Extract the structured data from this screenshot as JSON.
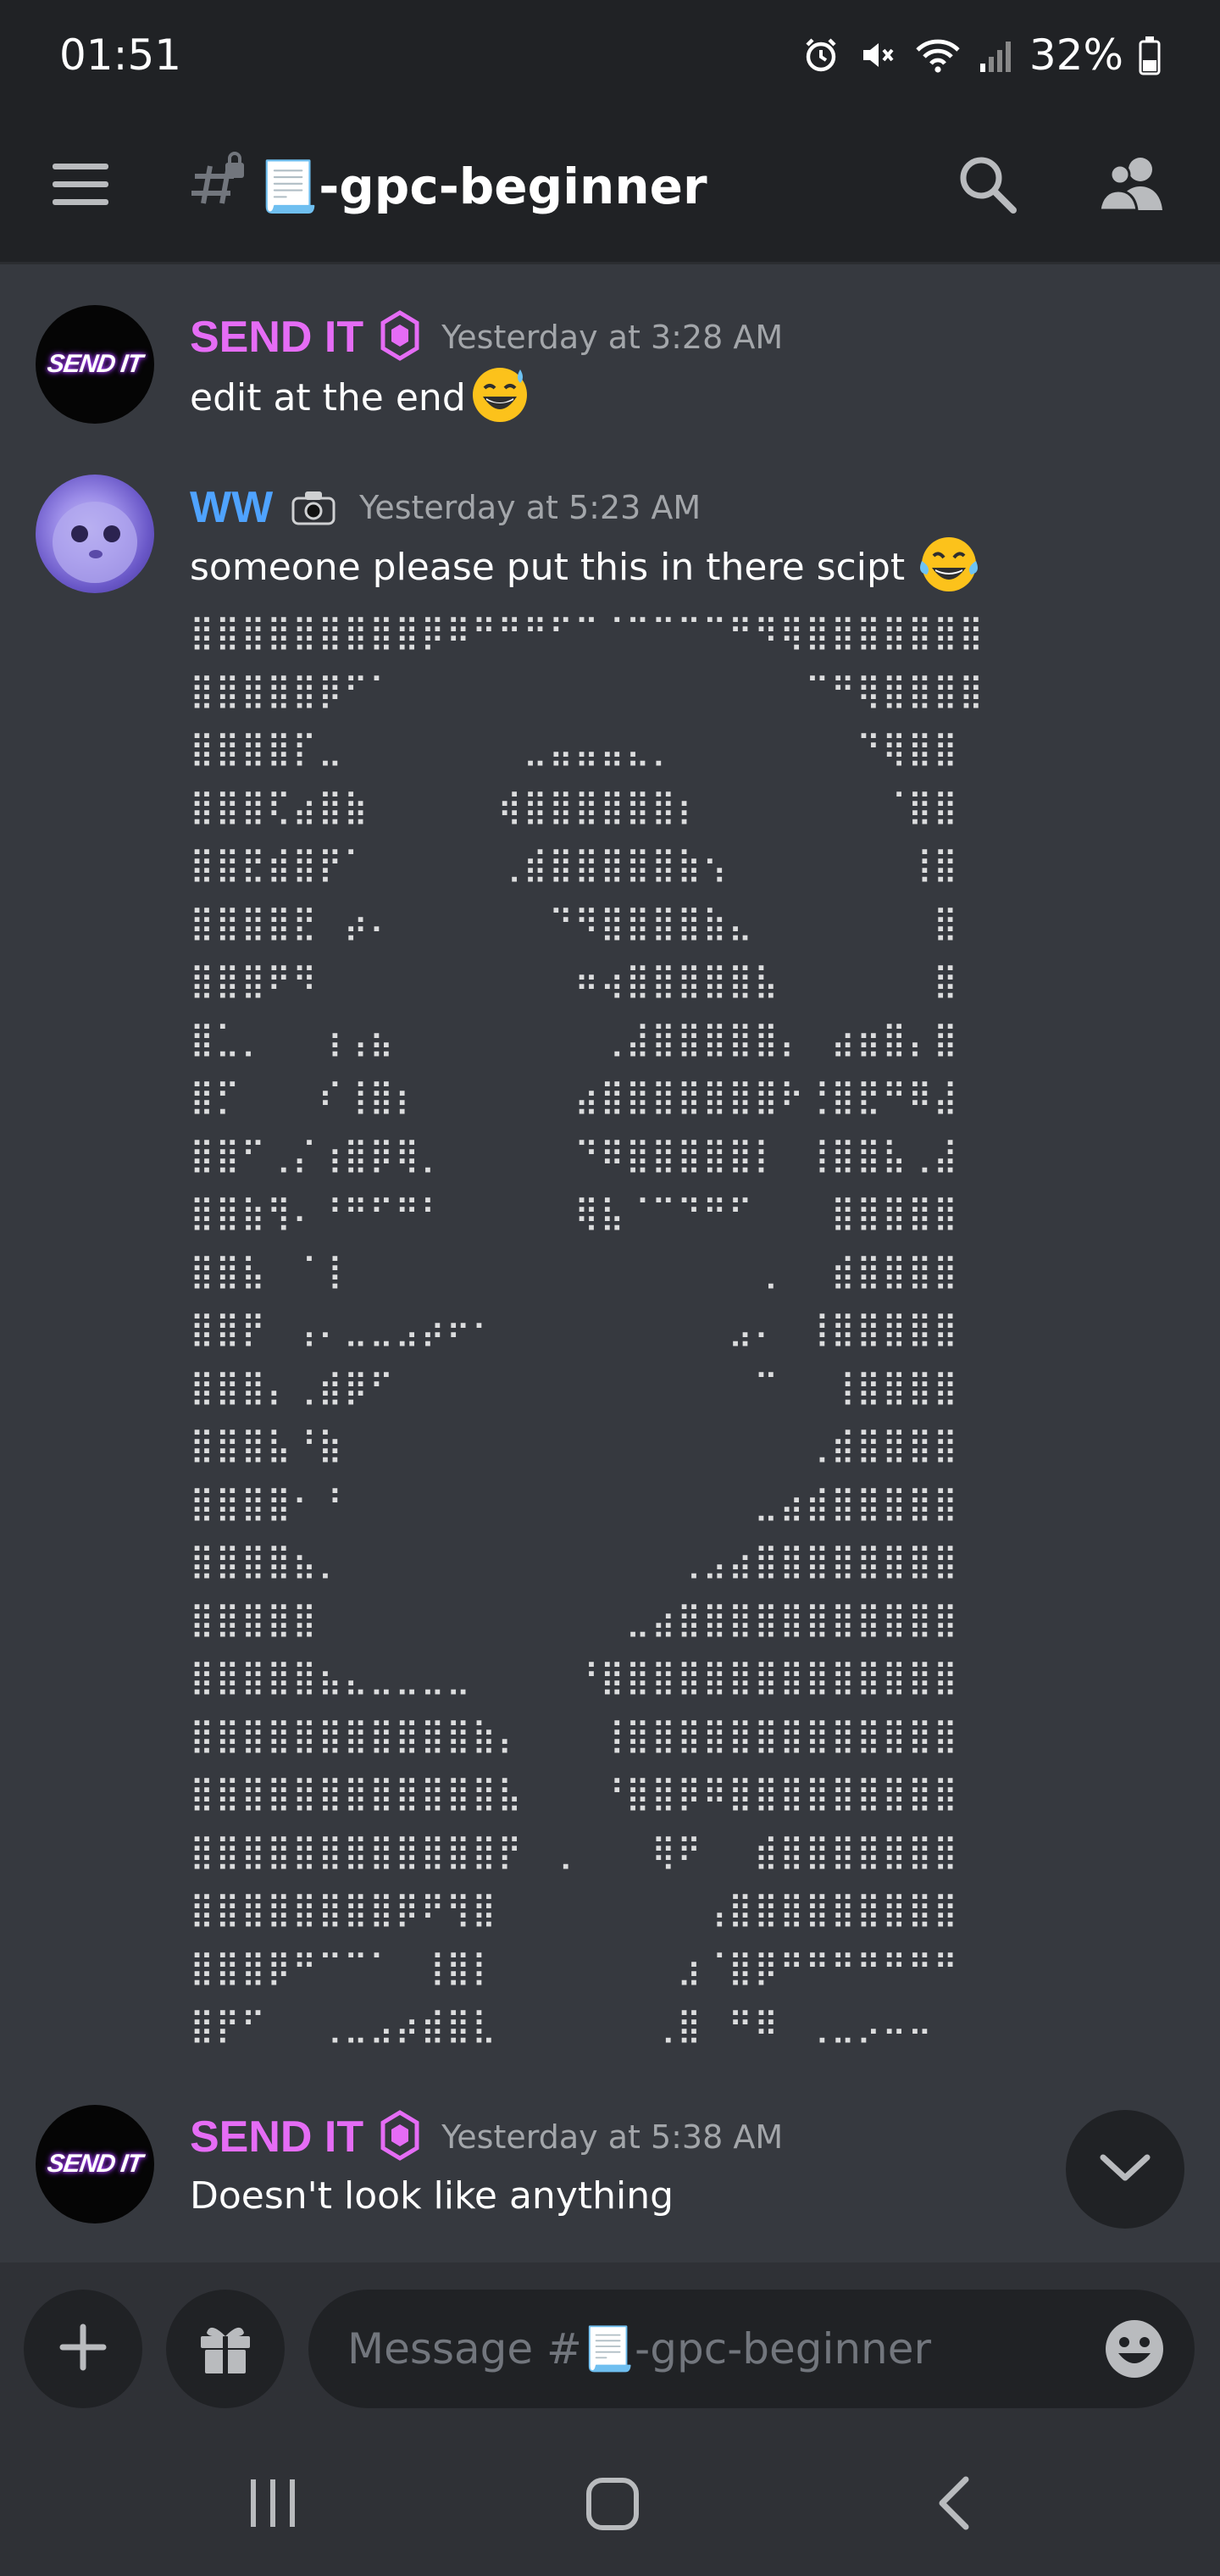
{
  "status_bar": {
    "time": "01:51",
    "battery_percent": "32%",
    "icons": [
      "alarm-icon",
      "mute-icon",
      "wifi-icon",
      "signal-icon",
      "battery-icon"
    ]
  },
  "header": {
    "channel_name": "📃-gpc-beginner",
    "icons": [
      "menu-icon",
      "locked-channel-icon",
      "search-icon",
      "members-icon"
    ]
  },
  "messages": [
    {
      "author": "SEND IT",
      "author_color": "#e56cf5",
      "badge": "gem-icon",
      "timestamp": "Yesterday at 3:28 AM",
      "text": "edit at the end",
      "emoji": "😅",
      "avatar_text": "SEND IT"
    },
    {
      "author": "WW",
      "author_color": "#4fa3ff",
      "badge": "camera-icon",
      "timestamp": "Yesterday at 5:23 AM",
      "text": "someone please put this in there scipt",
      "emoji": "😂"
    },
    {
      "author": "SEND IT",
      "author_color": "#e56cf5",
      "badge": "gem-icon",
      "timestamp": "Yesterday at 5:38 AM",
      "text": "Doesn't look like anything",
      "avatar_text": "SEND IT"
    }
  ],
  "ascii_art": [
    "⣿⣿⣿⣿⣿⣿⣿⣿⣿⡿⠿⠛⠛⠛⠋⠉⠈⠉⠉⠉⠉⠛⠻⢿⣿⣿⣿⣿⣿⣿⣿",
    "⣿⣿⣿⣿⣿⡿⠋⠁⠀⠀⠀⠀⠀⠀⠀⠀⠀⠀⠀⠀⠀⠀⠀⠀⠉⠛⢿⣿⣿⣿⣿",
    "⣿⣿⣿⣿⡏⣀⠀⠀⠀⠀⠀⠀⠀⣀⣤⣤⣤⣄⡀⠀⠀⠀⠀⠀⠀⠀⠙⢿⣿⣿",
    "⣿⣿⣿⢏⣴⣿⣷⠀⠀⠀⠀⠀⢾⣿⣿⣿⣿⣿⣿⡆⠀⠀⠀⠀⠀⠀⠀⠈⣿⣿",
    "⣿⣿⣟⣾⣿⡟⠁⠀⠀⠀⠀⠀⢀⣾⣿⣿⣿⣿⣿⣷⢢⠀⠀⠀⠀⠀⠀⠀⢸⣿",
    "⣿⣿⣿⣿⣟⠀⡴⠄⠀⠀⠀⠀⠀⠀⠙⠻⣿⣿⣿⣿⣷⣄⠀⠀⠀⠀⠀⠀⠀⣿",
    "⣿⣿⣿⠟⠻⠀⠀⠀⠀⠀⠀⠀⠀⠀⠀⠶⢴⣿⣿⣿⣿⣿⣧⠀⠀⠀⠀⠀⠀⣿",
    "⣿⣁⡀⠀⠀⢰⢠⣦⠀⠀⠀⠀⠀⠀⠀⠀⢀⣼⣿⣿⣿⣿⣿⡄⠀⣴⣶⣿⡄⣿",
    "⣿⡋⠀⠀⠀⠎⢸⣿⡆⠀⠀⠀⠀⠀⠀⣴⣿⣿⣿⣿⣿⣿⣿⠗⢘⣿⣟⠛⠿⣼",
    "⣿⣿⠋⢀⡌⢰⣿⡿⢿⡀⠀⠀⠀⠀⠀⠙⠿⣿⣿⣿⣿⣿⡇⠀⢸⣿⣿⣧⢀⣼",
    "⣿⣿⣷⢻⠄⠘⠛⠋⠛⠃⠀⠀⠀⠀⠀⢿⣧⠈⠉⠙⠛⠋⠀⠀⠀⣿⣿⣿⣿⣿",
    "⣿⣿⣧⠀⠈⢸⠀⠀⠀⠀⠀⠀⠀⠀⠀⠀⠀⠀⠀⠀⠀⠀⢀⠀⠀⣾⣿⣿⣿⣿",
    "⣿⣿⡟⠀⢠⠄⣀⣀⣠⡴⠖⠂⠀⠀⠀⠀⠀⠀⠀⠀⠀⣠⠄⠀⢸⣿⣿⣿⣿⣿",
    "⣿⣿⣿⡄⢀⣾⡿⠋⠀⠀⠀⠀⠀⠀⠀⠀⠀⠀⠀⠀⠀⠀⠉⠀⠀⢸⣿⣿⣿⣿",
    "⣿⣿⣿⣧⠘⣷⠀⠀⠀⠀⠀⠀⠀⠀⠀⠀⠀⠀⠀⠀⠀⠀⠀⠀⢀⣾⣿⣿⣿⣿",
    "⣿⣿⣿⣿⠂⠘⠀⠀⠀⠀⠀⠀⠀⠀⠀⠀⠀⠀⠀⠀⠀⠀⣀⣴⣾⣿⣿⣿⣿⣿",
    "⣿⣿⣿⣿⣦⡀⠀⠀⠀⠀⠀⠀⠀⠀⠀⠀⠀⠀⠀⢀⣠⣴⣿⣿⣿⣿⣿⣿⣿⣿",
    "⣿⣿⣿⣿⣿⠀⠀⠀⠀⠀⠀⠀⠀⠀⠀⠀⠀⣀⣴⣿⣿⣿⣿⣿⣿⣿⣿⣿⣿⣿",
    "⣿⣿⣿⣿⣿⣦⣄⣀⣀⣀⣀⠀⠀⠀⠀⠘⣿⣿⣿⣿⣿⣿⣿⣿⣿⣿⣿⣿⣿⣿",
    "⣿⣿⣿⣿⣿⣿⣿⣿⣿⣿⣿⣷⡄⠀⠀⠀⢸⣿⣿⣿⣿⣿⣿⣿⣿⣿⣿⣿⣿⣿",
    "⣿⣿⣿⣿⣿⣿⣿⣿⣿⣿⣿⣿⣧⠀⠀⠀⠘⣿⣿⡿⠿⣿⣿⣿⣿⣿⣿⣿⣿⣿",
    "⣿⣿⣿⣿⣿⣿⣿⣿⣿⣿⣿⣿⡟⠀⢀⠀⠀⠀⢿⠟⠀⠀⣾⣿⣿⣿⣿⣿⣿⣿",
    "⣿⣿⣿⣿⣿⣿⣿⣿⡿⠟⢻⣿⠀⠀⠀⠀⠀⠀⠀⠀⢠⣿⣿⣿⣿⣿⣿⣿⣿⣿",
    "⣿⣿⣿⡿⠛⠉⠉⠁⠀⢸⣿⡇⠀⠀⠀⠀⠀⠀⠀⣰⠈⣿⡿⠛⠛⠛⠛⠛⠛⠛",
    "⣿⡟⠋⠀⠀⢀⣀⣠⡴⣾⣿⣇⠀⠀⠀⠀⠀⠀⢀⣿⠀⠛⠿⠀⢀⣀⡠⠤⠤⠀"
  ],
  "jump_button_icon": "chevron-down-icon",
  "composer": {
    "placeholder": "Message #📃-gpc-beginner",
    "add_icon": "plus-icon",
    "gift_icon": "gift-icon",
    "emoji_icon": "emoji-icon"
  },
  "nav_bar": {
    "icons": [
      "recents-icon",
      "home-icon",
      "back-icon"
    ]
  },
  "colors": {
    "background": "#36393f",
    "header": "#202225",
    "purple": "#e56cf5",
    "blue": "#4fa3ff"
  }
}
